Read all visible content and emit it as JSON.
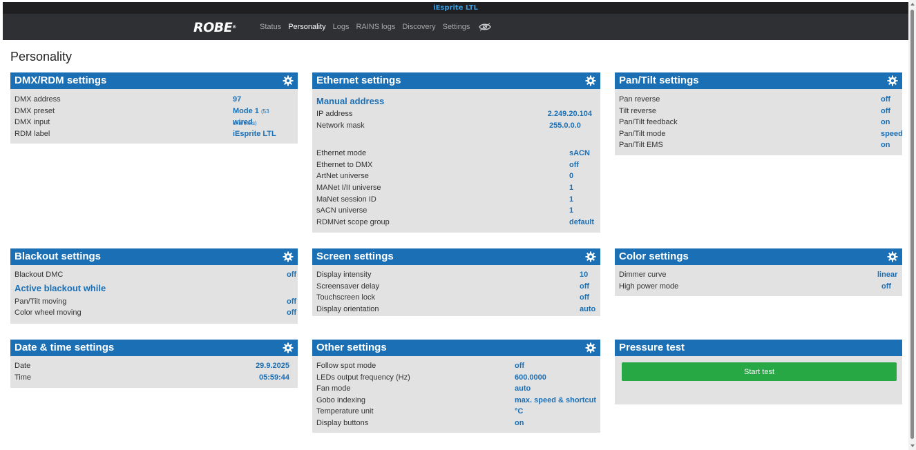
{
  "window_title": "iEsprite LTL",
  "logo": {
    "text": "ROBE",
    "mark": "®"
  },
  "nav": [
    "Status",
    "Personality",
    "Logs",
    "RAINS logs",
    "Discovery",
    "Settings"
  ],
  "nav_active": "Personality",
  "page_title": "Personality",
  "panels": {
    "dmx": {
      "title": "DMX/RDM settings",
      "rows": [
        {
          "label": "DMX address",
          "value": "97"
        },
        {
          "label": "DMX preset",
          "value": "Mode 1",
          "note": "(53 channels)"
        },
        {
          "label": "DMX input",
          "value": "wired"
        },
        {
          "label": "RDM label",
          "value": "iEsprite LTL"
        }
      ]
    },
    "ethernet": {
      "title": "Ethernet settings",
      "subheading": "Manual address",
      "rows_a": [
        {
          "label": "IP address",
          "value": "2.249.20.104"
        },
        {
          "label": "Network mask",
          "value": "255.0.0.0"
        }
      ],
      "rows_b": [
        {
          "label": "Ethernet mode",
          "value": "sACN"
        },
        {
          "label": "Ethernet to DMX",
          "value": "off"
        },
        {
          "label": "ArtNet universe",
          "value": "0"
        },
        {
          "label": "MANet I/II universe",
          "value": "1"
        },
        {
          "label": "MaNet session ID",
          "value": "1"
        },
        {
          "label": "sACN universe",
          "value": "1"
        },
        {
          "label": "RDMNet scope group",
          "value": "default"
        }
      ]
    },
    "pantilt": {
      "title": "Pan/Tilt settings",
      "rows": [
        {
          "label": "Pan reverse",
          "value": "off"
        },
        {
          "label": "Tilt reverse",
          "value": "off"
        },
        {
          "label": "Pan/Tilt feedback",
          "value": "on"
        },
        {
          "label": "Pan/Tilt mode",
          "value": "speed"
        },
        {
          "label": "Pan/Tilt EMS",
          "value": "on"
        }
      ]
    },
    "blackout": {
      "title": "Blackout settings",
      "rows_a": [
        {
          "label": "Blackout DMC",
          "value": "off"
        }
      ],
      "subheading": "Active blackout while",
      "rows_b": [
        {
          "label": "Pan/Tilt moving",
          "value": "off"
        },
        {
          "label": "Color wheel moving",
          "value": "off"
        }
      ]
    },
    "screen": {
      "title": "Screen settings",
      "rows": [
        {
          "label": "Display intensity",
          "value": "10"
        },
        {
          "label": "Screensaver delay",
          "value": "off"
        },
        {
          "label": "Touchscreen lock",
          "value": "off"
        },
        {
          "label": "Display orientation",
          "value": "auto"
        }
      ]
    },
    "color": {
      "title": "Color settings",
      "rows": [
        {
          "label": "Dimmer curve",
          "value": "linear"
        },
        {
          "label": "High power mode",
          "value": "off"
        }
      ]
    },
    "datetime": {
      "title": "Date & time settings",
      "rows": [
        {
          "label": "Date",
          "value": "29.9.2025"
        },
        {
          "label": "Time",
          "value": "05:59:44"
        }
      ]
    },
    "other": {
      "title": "Other settings",
      "rows": [
        {
          "label": "Follow spot mode",
          "value": "off"
        },
        {
          "label": "LEDs output frequency (Hz)",
          "value": "600.0000"
        },
        {
          "label": "Fan mode",
          "value": "auto"
        },
        {
          "label": "Gobo indexing",
          "value": "max. speed & shortcut"
        },
        {
          "label": "Temperature unit",
          "value": "°C"
        },
        {
          "label": "Display buttons",
          "value": "on"
        }
      ]
    },
    "pressure": {
      "title": "Pressure test",
      "button": "Start test"
    }
  },
  "colors": {
    "header": "#1a6fb5",
    "panel_bg": "#e2e2e2",
    "topbar": "#2f3033",
    "button": "#28a745",
    "value": "#1a6fb5"
  },
  "icons": [
    "gear-icon",
    "eye-icon"
  ]
}
